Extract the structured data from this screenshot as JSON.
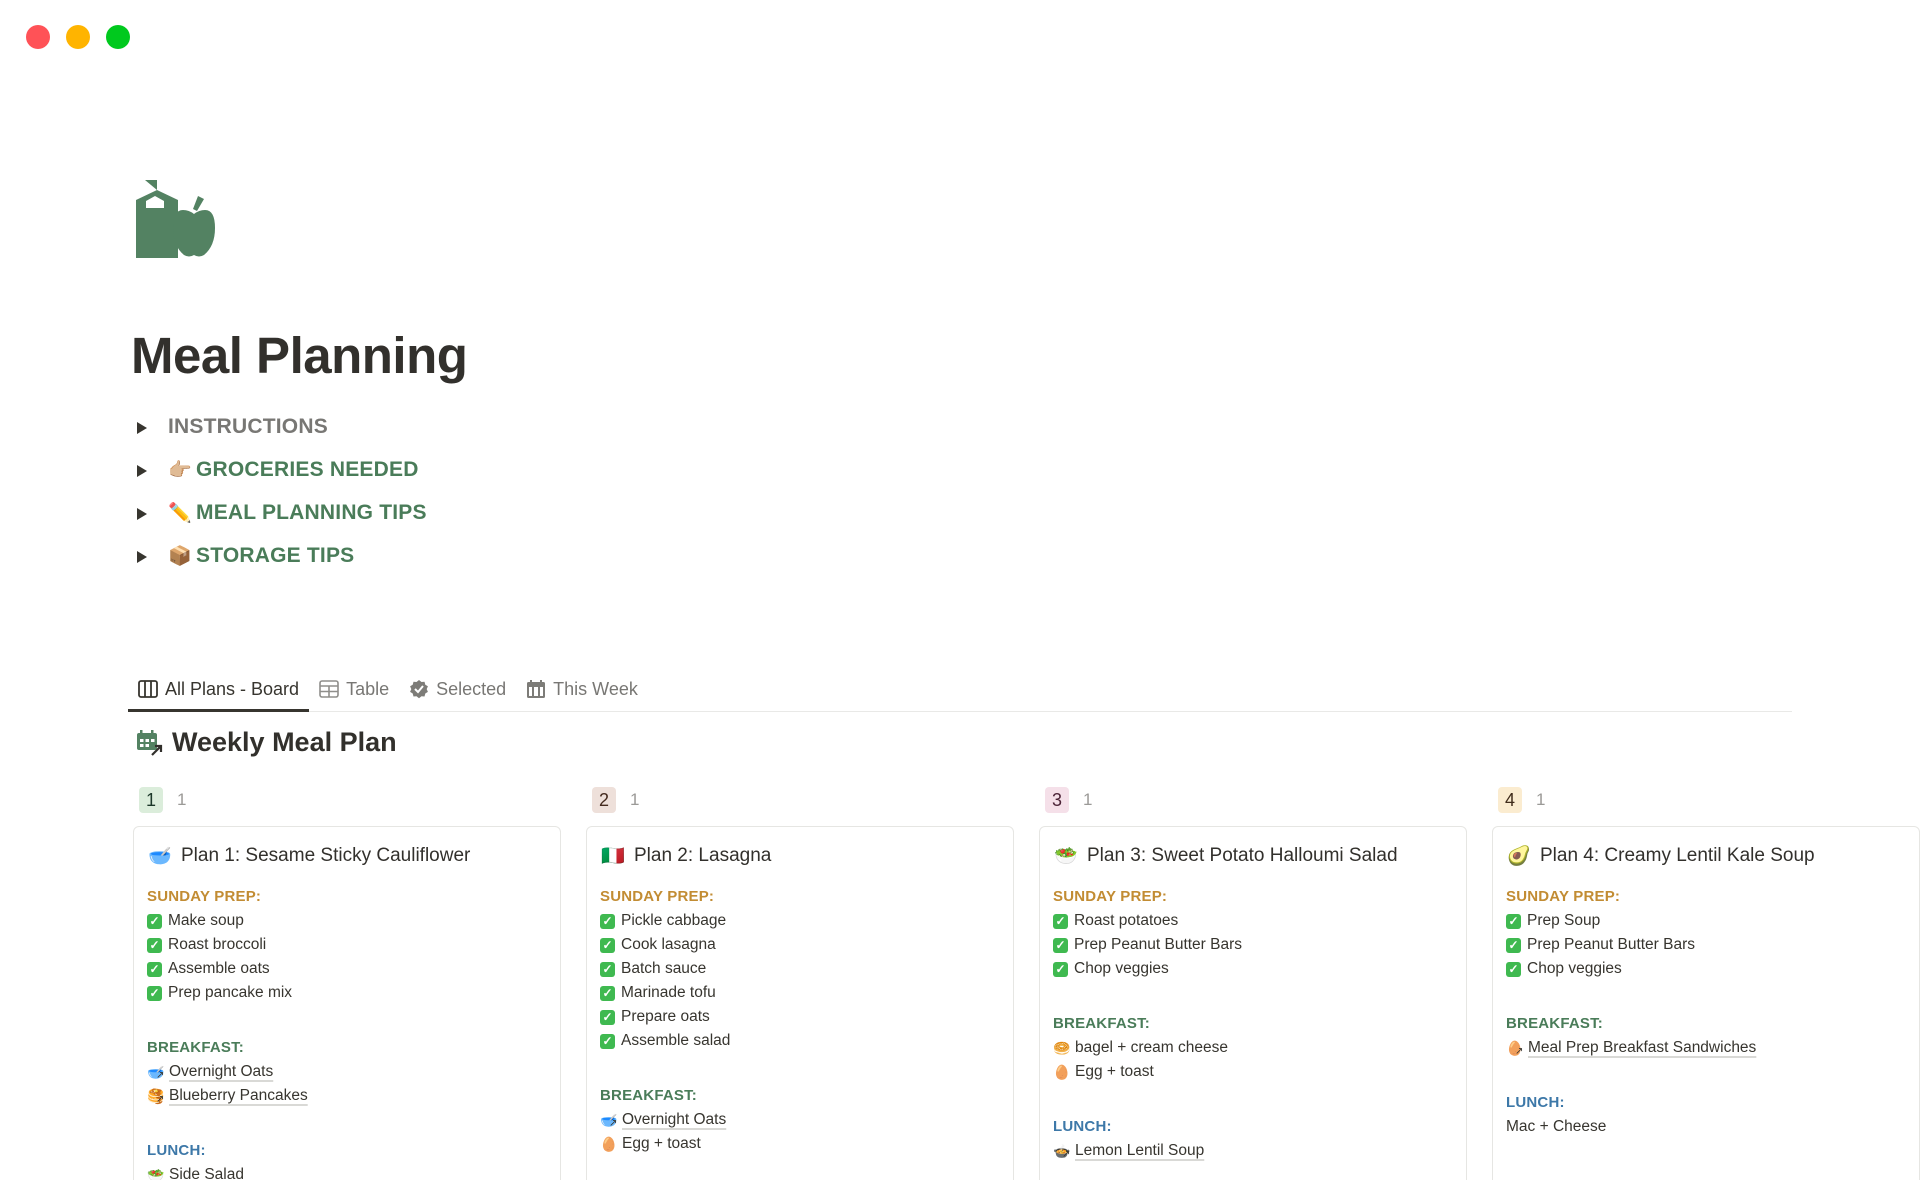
{
  "window": {
    "controls": [
      "close",
      "minimize",
      "maximize"
    ]
  },
  "page": {
    "icon": "grocery-bottle-apple-icon",
    "title": "Meal Planning",
    "accent_color": "#4a7c59"
  },
  "toggles": [
    {
      "emoji": "",
      "label": "INSTRUCTIONS",
      "color": "gray"
    },
    {
      "emoji": "👉🏼",
      "label": "GROCERIES NEEDED",
      "color": "green"
    },
    {
      "emoji": "✏️",
      "label": "MEAL PLANNING TIPS",
      "color": "green"
    },
    {
      "emoji": "📦",
      "label": "STORAGE TIPS",
      "color": "green"
    }
  ],
  "tabs": [
    {
      "icon": "board-icon",
      "label": "All Plans - Board",
      "active": true
    },
    {
      "icon": "table-icon",
      "label": "Table",
      "active": false
    },
    {
      "icon": "verified-check-icon",
      "label": "Selected",
      "active": false
    },
    {
      "icon": "calendar-icon",
      "label": "This Week",
      "active": false
    }
  ],
  "database": {
    "icon": "calendar-link-icon",
    "title": "Weekly Meal Plan"
  },
  "board": {
    "columns": [
      {
        "group": "1",
        "count": "1",
        "badge_bg": "#dbeddb",
        "badge_color": "#1c3829",
        "card": {
          "emoji": "🥣",
          "title": "Plan 1: Sesame Sticky Cauliflower",
          "sunday_prep_label": "SUNDAY PREP:",
          "sunday_prep": [
            "Make soup",
            "Roast broccoli",
            "Assemble oats",
            "Prep pancake mix"
          ],
          "breakfast_label": "BREAKFAST:",
          "breakfast": [
            {
              "emoji": "🥣",
              "text": "Overnight Oats",
              "linked": true
            },
            {
              "emoji": "🥞",
              "text": "Blueberry Pancakes",
              "linked": true
            }
          ],
          "lunch_label": "LUNCH:",
          "lunch": [
            {
              "emoji": "🥗",
              "text": "Side Salad",
              "linked": false
            }
          ]
        }
      },
      {
        "group": "2",
        "count": "1",
        "badge_bg": "#eee0da",
        "badge_color": "#442a1e",
        "card": {
          "emoji": "🇮🇹",
          "title": "Plan 2: Lasagna",
          "sunday_prep_label": "SUNDAY PREP:",
          "sunday_prep": [
            "Pickle cabbage",
            "Cook lasagna",
            "Batch sauce",
            "Marinade tofu",
            "Prepare oats",
            "Assemble salad"
          ],
          "breakfast_label": "BREAKFAST:",
          "breakfast": [
            {
              "emoji": "🥣",
              "text": "Overnight Oats",
              "linked": true
            },
            {
              "emoji": "🥚",
              "text": "Egg + toast",
              "linked": false
            }
          ],
          "lunch_label": "",
          "lunch": []
        }
      },
      {
        "group": "3",
        "count": "1",
        "badge_bg": "#f5e0e9",
        "badge_color": "#4c2337",
        "card": {
          "emoji": "🥗",
          "title": "Plan 3: Sweet Potato Halloumi Salad",
          "sunday_prep_label": "SUNDAY PREP:",
          "sunday_prep": [
            "Roast potatoes",
            "Prep Peanut Butter Bars",
            "Chop veggies"
          ],
          "breakfast_label": "BREAKFAST:",
          "breakfast": [
            {
              "emoji": "🥯",
              "text": "bagel + cream cheese",
              "linked": false
            },
            {
              "emoji": "🥚",
              "text": "Egg + toast",
              "linked": false
            }
          ],
          "lunch_label": "LUNCH:",
          "lunch": [
            {
              "emoji": "🍲",
              "text": "Lemon Lentil Soup",
              "linked": true
            }
          ]
        }
      },
      {
        "group": "4",
        "count": "1",
        "badge_bg": "#fbecd0",
        "badge_color": "#402c1b",
        "card": {
          "emoji": "🥑",
          "title": "Plan 4: Creamy Lentil Kale Soup",
          "sunday_prep_label": "SUNDAY PREP:",
          "sunday_prep": [
            "Prep Soup",
            "Prep Peanut Butter Bars",
            "Chop veggies"
          ],
          "breakfast_label": "BREAKFAST:",
          "breakfast": [
            {
              "emoji": "🥚",
              "text": "Meal Prep Breakfast Sandwiches",
              "linked": true
            }
          ],
          "lunch_label": "LUNCH:",
          "lunch": [
            {
              "emoji": "",
              "text": "Mac + Cheese",
              "linked": false
            }
          ]
        }
      }
    ]
  }
}
